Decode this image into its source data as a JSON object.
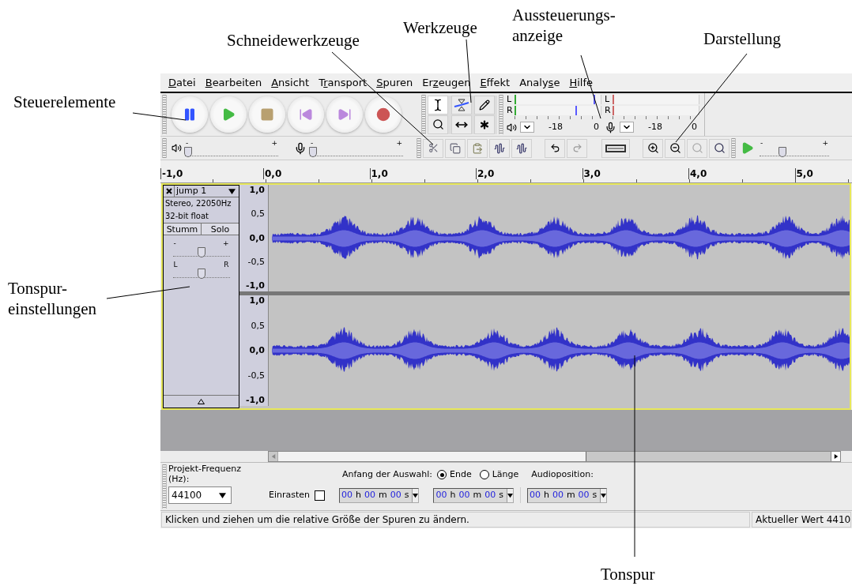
{
  "annotations": [
    {
      "lines": [
        "Steuerelemente"
      ]
    },
    {
      "lines": [
        "Schneidewerkzeuge"
      ]
    },
    {
      "lines": [
        "Werkzeuge"
      ]
    },
    {
      "lines": [
        "Aussteuerungs-",
        "anzeige"
      ]
    },
    {
      "lines": [
        "Darstellung"
      ]
    },
    {
      "lines": [
        "Tonspur-",
        "einstellungen"
      ]
    },
    {
      "lines": [
        "Tonspur"
      ]
    }
  ],
  "menu": [
    {
      "label": "Datei"
    },
    {
      "label": "Bearbeiten"
    },
    {
      "label": "Ansicht"
    },
    {
      "label": "Transport"
    },
    {
      "label": "Spuren"
    },
    {
      "label": "Erzeugen"
    },
    {
      "label": "Effekt"
    },
    {
      "label": "Analyse"
    },
    {
      "label": "Hilfe"
    }
  ],
  "meters": [
    {
      "channels": [
        {
          "label": "L",
          "level": 0.92
        },
        {
          "label": "R",
          "level": 0.7
        }
      ],
      "scale": [
        "-18",
        "0"
      ]
    },
    {
      "channels": [
        {
          "label": "L"
        },
        {
          "label": "R"
        }
      ],
      "scale": [
        "-18",
        "0"
      ]
    }
  ],
  "mixer": [
    {
      "min": "-",
      "max": "+",
      "level": 0.03
    },
    {
      "min": "-",
      "max": "+",
      "level": 0.03
    }
  ],
  "play_speed": {
    "min": "-",
    "max": "+",
    "level": 0.33
  },
  "ruler": [
    "-1,0",
    "0,0",
    "1,0",
    "2,0",
    "3,0",
    "4,0",
    "5,0"
  ],
  "track": {
    "name": "jump 1",
    "info": [
      "Stereo, 22050Hz",
      "32-bit float"
    ],
    "mute": "Stumm",
    "solo": "Solo",
    "gain": {
      "min": "-",
      "max": "+",
      "level": 0.5
    },
    "pan": {
      "min": "L",
      "max": "R",
      "level": 0.5
    },
    "channels": [
      {
        "scale": [
          {
            "label": "1,0",
            "major": true
          },
          {
            "label": "0,5",
            "major": false
          },
          {
            "label": "0,0",
            "major": true
          },
          {
            "label": "-0,5",
            "major": false
          },
          {
            "label": "-1,0",
            "major": true
          }
        ]
      },
      {
        "scale": [
          {
            "label": "1,0",
            "major": true
          },
          {
            "label": "0,5",
            "major": false
          },
          {
            "label": "0,0",
            "major": true
          },
          {
            "label": "-0,5",
            "major": false
          },
          {
            "label": "-1,0",
            "major": true
          }
        ]
      }
    ]
  },
  "selection_bar": {
    "rate_label": "Projekt-Frequenz (Hz):",
    "rate": "44100",
    "snap": {
      "label": "Einrasten",
      "checked": false
    },
    "selection_label": "Anfang der Auswahl:",
    "options": [
      {
        "label": "Ende",
        "selected": true
      },
      {
        "label": "Länge",
        "selected": false
      }
    ],
    "audio_position_label": "Audioposition:",
    "times": [
      [
        {
          "value": "00",
          "unit": "h"
        },
        {
          "value": "00",
          "unit": "m"
        },
        {
          "value": "00",
          "unit": "s"
        }
      ],
      [
        {
          "value": "00",
          "unit": "h"
        },
        {
          "value": "00",
          "unit": "m"
        },
        {
          "value": "00",
          "unit": "s"
        }
      ],
      [
        {
          "value": "00",
          "unit": "h"
        },
        {
          "value": "00",
          "unit": "m"
        },
        {
          "value": "00",
          "unit": "s"
        }
      ]
    ]
  },
  "status_bar": {
    "message": "Klicken und ziehen um die relative Größe der Spuren zu ändern.",
    "value": "Aktueller Wert 4410"
  }
}
